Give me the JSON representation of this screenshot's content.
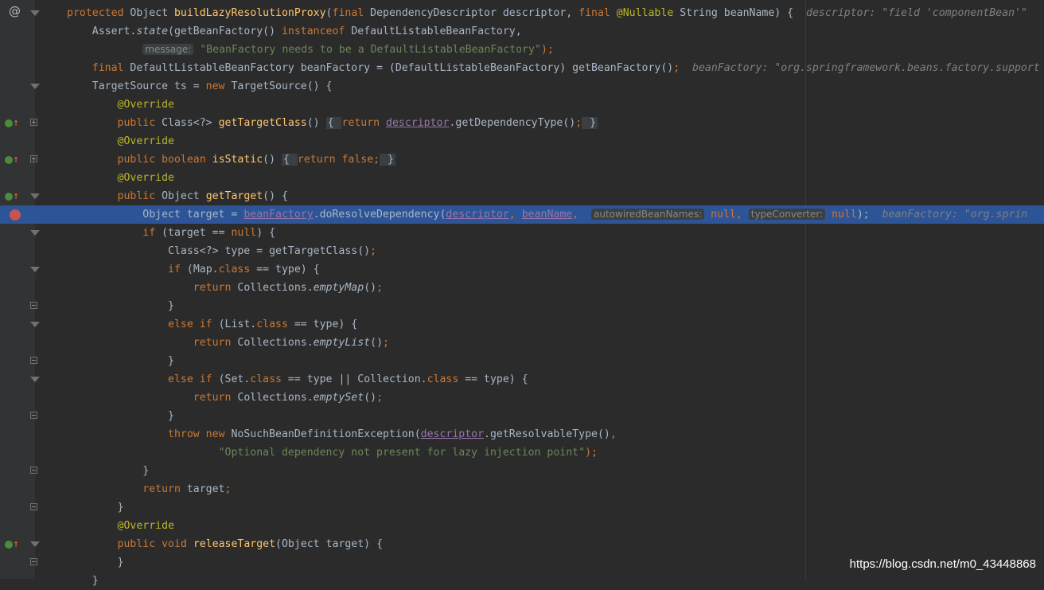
{
  "watermark": "https://blog.csdn.net/m0_43448868",
  "gutter_at_symbol": "@",
  "lines": [
    {
      "id": "l0",
      "tokens": [
        {
          "t": "protected ",
          "c": "kw"
        },
        {
          "t": "Object ",
          "c": ""
        },
        {
          "t": "buildLazyResolutionProxy",
          "c": "fn"
        },
        {
          "t": "(",
          "c": ""
        },
        {
          "t": "final ",
          "c": "kw"
        },
        {
          "t": "DependencyDescriptor descriptor, ",
          "c": ""
        },
        {
          "t": "final ",
          "c": "kw"
        },
        {
          "t": "@Nullable ",
          "c": "ann"
        },
        {
          "t": "String beanName) {  ",
          "c": ""
        },
        {
          "t": "descriptor: \"field 'componentBean'\"",
          "c": "cm"
        }
      ]
    },
    {
      "id": "l1",
      "tokens": [
        {
          "t": "    Assert.",
          "c": ""
        },
        {
          "t": "state",
          "c": "it"
        },
        {
          "t": "(getBeanFactory() ",
          "c": ""
        },
        {
          "t": "instanceof ",
          "c": "kw"
        },
        {
          "t": "DefaultListableBeanFactory,",
          "c": ""
        }
      ]
    },
    {
      "id": "l2",
      "tokens": [
        {
          "t": "            ",
          "c": ""
        },
        {
          "t": "message:",
          "c": "hint"
        },
        {
          "t": " \"BeanFactory needs to be a DefaultListableBeanFactory\"",
          "c": "str"
        },
        {
          "t": ");",
          "c": "kw"
        }
      ]
    },
    {
      "id": "l3",
      "tokens": [
        {
          "t": "    ",
          "c": ""
        },
        {
          "t": "final ",
          "c": "kw"
        },
        {
          "t": "DefaultListableBeanFactory beanFactory = (DefaultListableBeanFactory) getBeanFactory()",
          "c": ""
        },
        {
          "t": ";  ",
          "c": "kw"
        },
        {
          "t": "beanFactory: \"org.springframework.beans.factory.support",
          "c": "cm"
        }
      ]
    },
    {
      "id": "l4",
      "tokens": [
        {
          "t": "    TargetSource ts = ",
          "c": ""
        },
        {
          "t": "new ",
          "c": "kw"
        },
        {
          "t": "TargetSource() {",
          "c": ""
        }
      ]
    },
    {
      "id": "l5",
      "tokens": [
        {
          "t": "        ",
          "c": ""
        },
        {
          "t": "@Override",
          "c": "ann"
        }
      ]
    },
    {
      "id": "l6",
      "tokens": [
        {
          "t": "        ",
          "c": ""
        },
        {
          "t": "public ",
          "c": "kw"
        },
        {
          "t": "Class<?> ",
          "c": ""
        },
        {
          "t": "getTargetClass",
          "c": "fn"
        },
        {
          "t": "() ",
          "c": ""
        },
        {
          "t": "{ ",
          "c": "fold-box"
        },
        {
          "t": "return ",
          "c": "kw"
        },
        {
          "t": "descriptor",
          "c": "fld"
        },
        {
          "t": ".getDependencyType()",
          "c": ""
        },
        {
          "t": ";",
          "c": "kw"
        },
        {
          "t": " }",
          "c": "fold-box"
        }
      ]
    },
    {
      "id": "l7",
      "tokens": [
        {
          "t": "        ",
          "c": ""
        },
        {
          "t": "@Override",
          "c": "ann"
        }
      ]
    },
    {
      "id": "l8",
      "tokens": [
        {
          "t": "        ",
          "c": ""
        },
        {
          "t": "public boolean ",
          "c": "kw"
        },
        {
          "t": "isStatic",
          "c": "fn"
        },
        {
          "t": "() ",
          "c": ""
        },
        {
          "t": "{ ",
          "c": "fold-box"
        },
        {
          "t": "return false;",
          "c": "kw"
        },
        {
          "t": " }",
          "c": "fold-box"
        }
      ]
    },
    {
      "id": "l9",
      "tokens": [
        {
          "t": "        ",
          "c": ""
        },
        {
          "t": "@Override",
          "c": "ann"
        }
      ]
    },
    {
      "id": "l10",
      "tokens": [
        {
          "t": "        ",
          "c": ""
        },
        {
          "t": "public ",
          "c": "kw"
        },
        {
          "t": "Object ",
          "c": ""
        },
        {
          "t": "getTarget",
          "c": "fn"
        },
        {
          "t": "() {",
          "c": ""
        }
      ]
    },
    {
      "id": "l11",
      "tokens": [
        {
          "t": "            Object target = ",
          "c": ""
        },
        {
          "t": "beanFactory",
          "c": "fld"
        },
        {
          "t": ".doResolveDependency(",
          "c": ""
        },
        {
          "t": "descriptor",
          "c": "fld"
        },
        {
          "t": ", ",
          "c": "kw"
        },
        {
          "t": "beanName",
          "c": "fld"
        },
        {
          "t": ",  ",
          "c": "kw"
        },
        {
          "t": "autowiredBeanNames:",
          "c": "hint"
        },
        {
          "t": " null, ",
          "c": "kw"
        },
        {
          "t": "typeConverter:",
          "c": "hint"
        },
        {
          "t": " null",
          "c": "kw"
        },
        {
          "t": ");  ",
          "c": ""
        },
        {
          "t": "beanFactory: \"org.sprin",
          "c": "cm"
        }
      ]
    },
    {
      "id": "l12",
      "tokens": [
        {
          "t": "            ",
          "c": ""
        },
        {
          "t": "if ",
          "c": "kw"
        },
        {
          "t": "(target == ",
          "c": ""
        },
        {
          "t": "null",
          "c": "kw"
        },
        {
          "t": ") {",
          "c": ""
        }
      ]
    },
    {
      "id": "l13",
      "tokens": [
        {
          "t": "                Class<?> type = getTargetClass()",
          "c": ""
        },
        {
          "t": ";",
          "c": "kw"
        }
      ]
    },
    {
      "id": "l14",
      "tokens": [
        {
          "t": "                ",
          "c": ""
        },
        {
          "t": "if ",
          "c": "kw"
        },
        {
          "t": "(Map.",
          "c": ""
        },
        {
          "t": "class ",
          "c": "kw"
        },
        {
          "t": "== type) {",
          "c": ""
        }
      ]
    },
    {
      "id": "l15",
      "tokens": [
        {
          "t": "                    ",
          "c": ""
        },
        {
          "t": "return ",
          "c": "kw"
        },
        {
          "t": "Collections.",
          "c": ""
        },
        {
          "t": "emptyMap",
          "c": "it"
        },
        {
          "t": "()",
          "c": ""
        },
        {
          "t": ";",
          "c": "kw"
        }
      ]
    },
    {
      "id": "l16",
      "tokens": [
        {
          "t": "                }",
          "c": ""
        }
      ]
    },
    {
      "id": "l17",
      "tokens": [
        {
          "t": "                ",
          "c": ""
        },
        {
          "t": "else if ",
          "c": "kw"
        },
        {
          "t": "(List.",
          "c": ""
        },
        {
          "t": "class ",
          "c": "kw"
        },
        {
          "t": "== type) {",
          "c": ""
        }
      ]
    },
    {
      "id": "l18",
      "tokens": [
        {
          "t": "                    ",
          "c": ""
        },
        {
          "t": "return ",
          "c": "kw"
        },
        {
          "t": "Collections.",
          "c": ""
        },
        {
          "t": "emptyList",
          "c": "it"
        },
        {
          "t": "()",
          "c": ""
        },
        {
          "t": ";",
          "c": "kw"
        }
      ]
    },
    {
      "id": "l19",
      "tokens": [
        {
          "t": "                }",
          "c": ""
        }
      ]
    },
    {
      "id": "l20",
      "tokens": [
        {
          "t": "                ",
          "c": ""
        },
        {
          "t": "else if ",
          "c": "kw"
        },
        {
          "t": "(Set.",
          "c": ""
        },
        {
          "t": "class ",
          "c": "kw"
        },
        {
          "t": "== type || Collection.",
          "c": ""
        },
        {
          "t": "class ",
          "c": "kw"
        },
        {
          "t": "== type) {",
          "c": ""
        }
      ]
    },
    {
      "id": "l21",
      "tokens": [
        {
          "t": "                    ",
          "c": ""
        },
        {
          "t": "return ",
          "c": "kw"
        },
        {
          "t": "Collections.",
          "c": ""
        },
        {
          "t": "emptySet",
          "c": "it"
        },
        {
          "t": "()",
          "c": ""
        },
        {
          "t": ";",
          "c": "kw"
        }
      ]
    },
    {
      "id": "l22",
      "tokens": [
        {
          "t": "                }",
          "c": ""
        }
      ]
    },
    {
      "id": "l23",
      "tokens": [
        {
          "t": "                ",
          "c": ""
        },
        {
          "t": "throw new ",
          "c": "kw"
        },
        {
          "t": "NoSuchBeanDefinitionException(",
          "c": ""
        },
        {
          "t": "descriptor",
          "c": "fld"
        },
        {
          "t": ".getResolvableType()",
          "c": ""
        },
        {
          "t": ",",
          "c": "kw"
        }
      ]
    },
    {
      "id": "l24",
      "tokens": [
        {
          "t": "                        ",
          "c": ""
        },
        {
          "t": "\"Optional dependency not present for lazy injection point\"",
          "c": "str"
        },
        {
          "t": ");",
          "c": "kw"
        }
      ]
    },
    {
      "id": "l25",
      "tokens": [
        {
          "t": "            }",
          "c": ""
        }
      ]
    },
    {
      "id": "l26",
      "tokens": [
        {
          "t": "            ",
          "c": ""
        },
        {
          "t": "return ",
          "c": "kw"
        },
        {
          "t": "target",
          "c": ""
        },
        {
          "t": ";",
          "c": "kw"
        }
      ]
    },
    {
      "id": "l27",
      "tokens": [
        {
          "t": "        }",
          "c": ""
        }
      ]
    },
    {
      "id": "l28",
      "tokens": [
        {
          "t": "        ",
          "c": ""
        },
        {
          "t": "@Override",
          "c": "ann"
        }
      ]
    },
    {
      "id": "l29",
      "tokens": [
        {
          "t": "        ",
          "c": ""
        },
        {
          "t": "public void ",
          "c": "kw"
        },
        {
          "t": "releaseTarget",
          "c": "fn"
        },
        {
          "t": "(Object target) {",
          "c": ""
        }
      ]
    },
    {
      "id": "l30",
      "tokens": [
        {
          "t": "        }",
          "c": ""
        }
      ]
    },
    {
      "id": "l31",
      "tokens": [
        {
          "t": "    }",
          "c": ""
        }
      ]
    }
  ]
}
